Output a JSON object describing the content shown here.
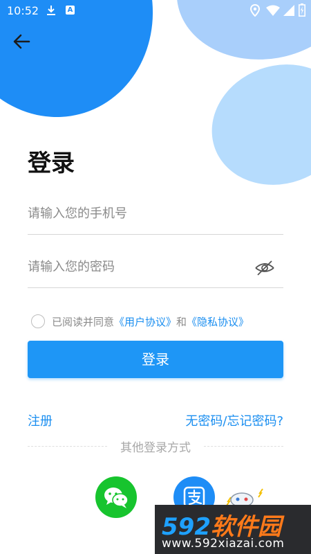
{
  "colors": {
    "primary": "#1e96f6",
    "link": "#1a8ef0",
    "wechat": "#17c42e",
    "alipay": "#1e8df6",
    "text": "#111111",
    "placeholder": "#8a8a8a"
  },
  "statusbar": {
    "time": "10:52",
    "icons": [
      "download-icon",
      "a-badge-icon",
      "location-icon",
      "wifi-icon",
      "signal-icon",
      "battery-icon"
    ],
    "a_badge": "A"
  },
  "header": {
    "back_icon": "arrow-left-icon"
  },
  "login": {
    "title": "登录",
    "phone_placeholder": "请输入您的手机号",
    "password_placeholder": "请输入您的密码",
    "password_visibility_icon": "eye-off-icon",
    "agreement": {
      "prefix": "已阅读并同意",
      "user_agreement": "《用户协议》",
      "and": "和",
      "privacy_policy": "《隐私协议》"
    },
    "submit_label": "登录",
    "register_label": "注册",
    "forgot_label": "无密码/忘记密码?",
    "other_login_label": "其他登录方式",
    "other_login_methods": [
      "wechat-icon",
      "alipay-icon"
    ]
  },
  "watermark": {
    "logo_number": "592",
    "logo_text": "软件园",
    "url": "www.592xiazai.com"
  }
}
